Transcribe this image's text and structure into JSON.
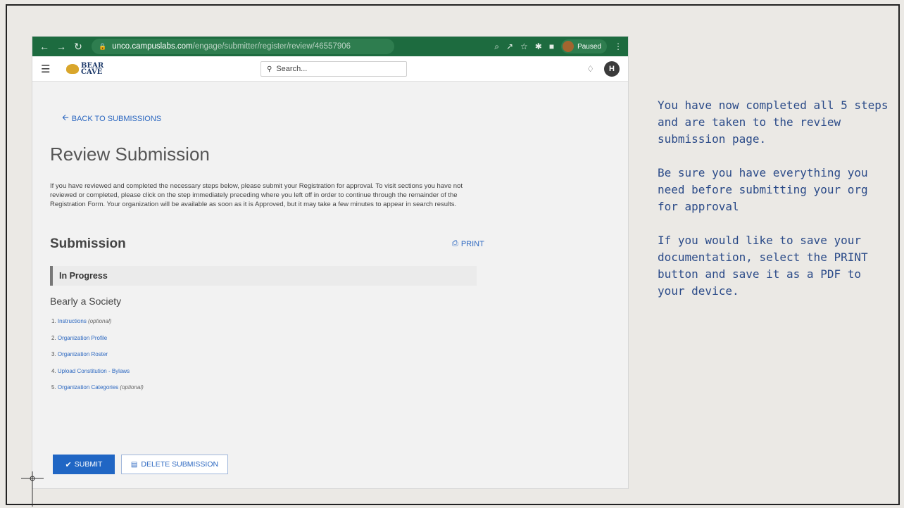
{
  "browser": {
    "url_host": "unco.campuslabs.com",
    "url_path": "/engage/submitter/register/review/46557906",
    "profile_status": "Paused"
  },
  "app": {
    "logo_line1": "BEAR",
    "logo_line2": "CAVE",
    "search_placeholder": "Search...",
    "avatar_initial": "H"
  },
  "page": {
    "back_link": "BACK TO SUBMISSIONS",
    "title": "Review Submission",
    "intro": "If you have reviewed and completed the necessary steps below, please submit your Registration for approval. To visit sections you have not reviewed or completed, please click on the step immediately preceding where you left off in order to continue through the remainder of the Registration Form. Your organization will be available as soon as it is Approved, but it may take a few minutes to appear in search results.",
    "section_title": "Submission",
    "print_label": "PRINT",
    "status": "In Progress",
    "org_name": "Bearly a Society",
    "steps": [
      {
        "num": "1.",
        "label": "Instructions",
        "note": "(optional)"
      },
      {
        "num": "2.",
        "label": "Organization Profile",
        "note": ""
      },
      {
        "num": "3.",
        "label": "Organization Roster",
        "note": ""
      },
      {
        "num": "4.",
        "label": "Upload Constitution - Bylaws",
        "note": ""
      },
      {
        "num": "5.",
        "label": "Organization Categories",
        "note": "(optional)"
      }
    ],
    "submit_label": "SUBMIT",
    "delete_label": "DELETE SUBMISSION"
  },
  "callout": {
    "para1": "You have now completed all 5 steps and are taken to the review submission page.",
    "para2": "Be sure you have everything you need before submitting your org for approval",
    "para3": "If you would like to save your documentation, select the PRINT button and save it as a PDF to your device."
  },
  "colors": {
    "chrome_green": "#1d6b3f",
    "link_blue": "#2b67c0",
    "submit_blue": "#2066c4",
    "callout_blue": "#2a4a88"
  }
}
